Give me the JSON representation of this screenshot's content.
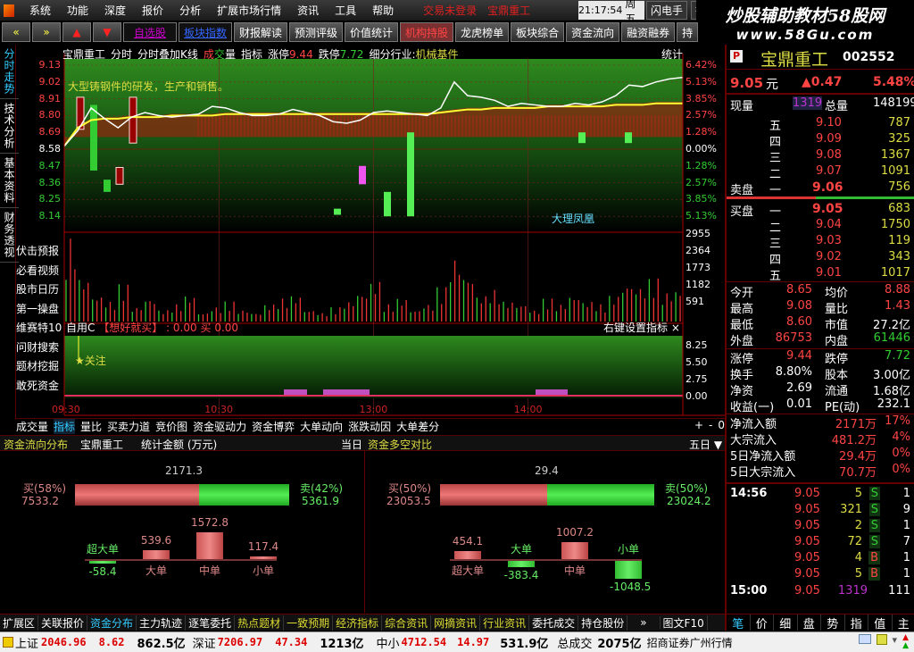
{
  "menu": [
    "系统",
    "功能",
    "深度",
    "报价",
    "分析",
    "扩展市场行情",
    "资讯",
    "工具",
    "帮助"
  ],
  "menu_alerts": [
    "交易未登录",
    "宝鼎重工"
  ],
  "clock": {
    "time": "21:17:54",
    "day": "周五"
  },
  "top_buttons": [
    "闪电手",
    "行情"
  ],
  "watermark": {
    "line1": "炒股辅助教材58股网",
    "line2": "www.58Gu.com"
  },
  "toolbar": {
    "nav": [
      "«",
      "»",
      "▲",
      "▼"
    ],
    "links": [
      "自选股",
      "板块指数"
    ],
    "buttons": [
      "财报解读",
      "预测评级",
      "价值统计",
      "机构持股",
      "龙虎榜单",
      "板块综合",
      "资金流向",
      "融资融券",
      "持"
    ]
  },
  "vtabs": [
    "分时走势",
    "技术分析",
    "基本资料",
    "财务透视"
  ],
  "chart_header": {
    "name": "宝鼎重工",
    "items": [
      "分时",
      "分时叠加K线"
    ],
    "vol_label_a": "成",
    "vol_label_b": "交",
    "vol_label_c": "量",
    "indicator": "指标",
    "limit_up_label": "涨停",
    "limit_up": "9.44",
    "limit_down_label": "跌停",
    "limit_down": "7.72",
    "industry_label": "细分行业:",
    "industry": "机械基件",
    "stat": "统计"
  },
  "annotation": "大型铸钢件的研发，生产和销售。",
  "region_label": "大理凤凰",
  "price_axis": [
    "9.13",
    "9.02",
    "8.91",
    "8.80",
    "8.69",
    "8.58",
    "8.47",
    "8.36",
    "8.25",
    "8.14"
  ],
  "pct_axis": [
    "6.42%",
    "5.13%",
    "3.85%",
    "2.57%",
    "1.28%",
    "0.00%",
    "1.28%",
    "2.57%",
    "3.85%",
    "5.13%"
  ],
  "vol_axis": [
    "2955",
    "2364",
    "1773",
    "1182",
    "591"
  ],
  "chart_data": {
    "type": "line",
    "prev_close": 8.58,
    "price_range": [
      8.03,
      9.13
    ],
    "price": [
      8.6,
      8.7,
      8.85,
      8.78,
      8.72,
      8.79,
      8.82,
      8.8,
      8.79,
      8.8,
      8.81,
      8.86,
      8.85,
      8.82,
      8.8,
      8.8,
      8.81,
      8.84,
      8.82,
      8.8,
      8.76,
      8.75,
      8.77,
      8.82,
      8.83,
      8.82,
      8.81,
      8.8,
      8.85,
      9.02,
      8.93,
      8.92,
      8.9,
      8.86,
      8.88,
      8.87,
      8.86,
      8.86,
      8.88,
      8.87,
      8.89,
      8.93,
      9.0,
      8.99,
      9.02,
      9.04,
      9.05
    ],
    "avg": [
      8.6,
      8.72,
      8.77,
      8.78,
      8.78,
      8.79,
      8.79,
      8.79,
      8.8,
      8.8,
      8.8,
      8.8,
      8.81,
      8.81,
      8.81,
      8.81,
      8.81,
      8.81,
      8.81,
      8.81,
      8.81,
      8.81,
      8.81,
      8.81,
      8.81,
      8.81,
      8.81,
      8.81,
      8.82,
      8.83,
      8.84,
      8.84,
      8.85,
      8.85,
      8.85,
      8.85,
      8.86,
      8.86,
      8.86,
      8.86,
      8.86,
      8.87,
      8.87,
      8.87,
      8.88,
      8.88,
      8.88
    ],
    "volume": [
      2900,
      1500,
      900,
      700,
      1300,
      500,
      800,
      400,
      600,
      900,
      300,
      500,
      700,
      400,
      300,
      600,
      800,
      900,
      400,
      300,
      500,
      700,
      1000,
      1400,
      600,
      800,
      400,
      600,
      1200,
      2200,
      1600,
      900,
      1100,
      700,
      600,
      400,
      800,
      600,
      900,
      700,
      600,
      900,
      1300,
      1200,
      1500,
      1000,
      1100
    ],
    "time_labels": [
      "09:30",
      "10:30",
      "13:00",
      "14:00"
    ]
  },
  "left_list": [
    "伏击预报",
    "必看视频",
    "股市日历",
    "第一操盘",
    "维赛特10",
    "问财搜索",
    "题材挖掘",
    "敢死资金"
  ],
  "indicator_panel": {
    "title": "自用C",
    "formula": "【想好就买】",
    "v1": ": 0.00",
    "buy": "买",
    "v2": "0.00",
    "right": "右键设置指标 ×",
    "signal": "★关注",
    "axis": [
      "8.25",
      "5.50",
      "2.75",
      "0.00"
    ]
  },
  "func_tabs": [
    "成交量",
    "指标",
    "量比",
    "买卖力道",
    "竞价图",
    "资金驱动力",
    "资金博弈",
    "大单动向",
    "涨跌动因",
    "大单差分"
  ],
  "func_tabs_active": 1,
  "zoom_buttons": [
    "+",
    "-",
    "0"
  ],
  "fund_header": {
    "title": "资金流向分布",
    "stock": "宝鼎重工",
    "unit": "统计金额 (万元)",
    "today": "当日",
    "title2": "资金多空对比",
    "period": "五日 ▼"
  },
  "fund_today": {
    "net": "2171.3",
    "buy_label": "买(58%)",
    "buy": "7533.2",
    "sell_label": "卖(42%)",
    "sell": "5361.9",
    "buy_pct": 58,
    "orders": [
      {
        "label": "超大单",
        "value": -58.4
      },
      {
        "label": "大单",
        "value": 539.6
      },
      {
        "label": "中单",
        "value": 1572.8
      },
      {
        "label": "小单",
        "value": 117.4
      }
    ]
  },
  "fund_5day": {
    "net": "29.4",
    "buy_label": "买(50%)",
    "buy": "23053.5",
    "sell_label": "卖(50%)",
    "sell": "23024.2",
    "buy_pct": 50,
    "orders": [
      {
        "label": "超大单",
        "value": 454.1
      },
      {
        "label": "大单",
        "value": -383.4
      },
      {
        "label": "中单",
        "value": 1007.2
      },
      {
        "label": "小单",
        "value": -1048.5
      }
    ]
  },
  "bottom_tabs": [
    "扩展区",
    "关联报价",
    "资金分布",
    "主力轨迹",
    "逐笔委托",
    "热点题材",
    "一致预期",
    "经济指标",
    "综合资讯",
    "网摘资讯",
    "行业资讯",
    "委托成交",
    "持仓股份",
    "»",
    "图文F10"
  ],
  "status": {
    "sh_label": "上证",
    "sh": "2046.96",
    "sh_chg": "8.62",
    "sh_amt": "862.5亿",
    "sz_label": "深证",
    "sz": "7206.97",
    "sz_chg": "47.34",
    "sz_amt": "1213亿",
    "zx_label": "中小",
    "zx": "4712.54",
    "zx_chg": "14.97",
    "zx_amt": "531.9亿",
    "total_label": "总成交",
    "total": "2075亿",
    "broker": "招商证券广州行情"
  },
  "quote": {
    "badge": "P",
    "name": "宝鼎重工",
    "code": "002552",
    "price": "9.05",
    "unit": "元",
    "change": "▲0.47",
    "pct": "5.48%",
    "cur_vol_label": "现量",
    "cur_vol": "1319",
    "tot_vol_label": "总量",
    "tot_vol": "148199",
    "sell_label": "卖盘",
    "buy_label": "买盘",
    "asks": [
      {
        "lv": "五",
        "p": "9.10",
        "v": "787"
      },
      {
        "lv": "四",
        "p": "9.09",
        "v": "325"
      },
      {
        "lv": "三",
        "p": "9.08",
        "v": "1367"
      },
      {
        "lv": "二",
        "p": "9.07",
        "v": "1091"
      },
      {
        "lv": "一",
        "p": "9.06",
        "v": "756"
      }
    ],
    "bids": [
      {
        "lv": "一",
        "p": "9.05",
        "v": "683"
      },
      {
        "lv": "二",
        "p": "9.04",
        "v": "1750"
      },
      {
        "lv": "三",
        "p": "9.03",
        "v": "119"
      },
      {
        "lv": "四",
        "p": "9.02",
        "v": "343"
      },
      {
        "lv": "五",
        "p": "9.01",
        "v": "1017"
      }
    ],
    "stats": [
      [
        "今开",
        "8.65",
        "均价",
        "8.88"
      ],
      [
        "最高",
        "9.08",
        "量比",
        "1.43"
      ],
      [
        "最低",
        "8.60",
        "市值",
        "27.2亿"
      ],
      [
        "外盘",
        "86753",
        "内盘",
        "61446"
      ],
      [
        "涨停",
        "9.44",
        "跌停",
        "7.72"
      ],
      [
        "换手",
        "8.80%",
        "股本",
        "3.00亿"
      ],
      [
        "净资",
        "2.69",
        "流通",
        "1.68亿"
      ],
      [
        "收益(一)",
        "0.01",
        "PE(动)",
        "232.1"
      ]
    ],
    "flows": [
      [
        "净流入额",
        "2171万",
        "17%"
      ],
      [
        "大宗流入",
        "481.2万",
        "4%"
      ],
      [
        "5日净流入额",
        "29.4万",
        "0%"
      ],
      [
        "5日大宗流入",
        "70.7万",
        "0%"
      ]
    ],
    "ticks": [
      [
        "14:56",
        "9.05",
        "5",
        "S",
        "1"
      ],
      [
        "",
        "9.05",
        "321",
        "S",
        "9"
      ],
      [
        "",
        "9.05",
        "2",
        "S",
        "1"
      ],
      [
        "",
        "9.05",
        "72",
        "S",
        "7"
      ],
      [
        "",
        "9.05",
        "4",
        "B",
        "1"
      ],
      [
        "",
        "9.05",
        "5",
        "B",
        "1"
      ],
      [
        "15:00",
        "9.05",
        "1319",
        "",
        "111"
      ]
    ],
    "tabs": [
      "笔",
      "价",
      "细",
      "盘",
      "势",
      "指",
      "值",
      "主"
    ]
  }
}
